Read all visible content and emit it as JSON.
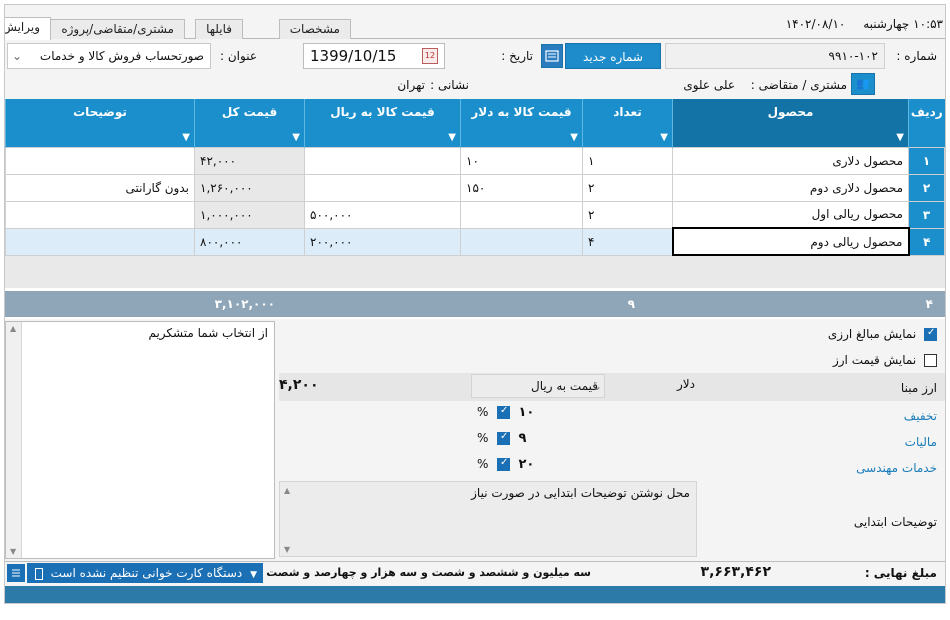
{
  "header": {
    "time": "۱۰:۵۳",
    "weekday": "چهارشنبه",
    "date": "۱۴۰۲/۰۸/۱۰"
  },
  "tabs": [
    {
      "label": "ویرایش"
    },
    {
      "label": "مشتری/متقاضی/پروژه"
    },
    {
      "label": "فایلها"
    },
    {
      "label": "مشخصات"
    }
  ],
  "invoice": {
    "number_label": "شماره :",
    "number_value": "۹۹۱۰-۱۰۲",
    "new_number_button": "شماره جدید",
    "date_label": "تاریخ :",
    "date_value": "1399/10/15",
    "title_label": "عنوان :",
    "title_value": "صورتحساب فروش کالا و خدمات",
    "customer_label": "مشتری / متقاضی :",
    "customer_value": "علی علوی",
    "address_label": "نشانی :",
    "address_value": "تهران"
  },
  "grid": {
    "columns": [
      "ردیف",
      "محصول",
      "تعداد",
      "قیمت کالا به دلار",
      "قیمت کالا به ریال",
      "قیمت کل",
      "توضیحات"
    ],
    "rows": [
      {
        "n": "۱",
        "product": "محصول دلاری",
        "qty": "۱",
        "usd": "۱۰",
        "rial": "",
        "total": "۴۲,۰۰۰",
        "desc": ""
      },
      {
        "n": "۲",
        "product": "محصول دلاری دوم",
        "qty": "۲",
        "usd": "۱۵۰",
        "rial": "",
        "total": "۱,۲۶۰,۰۰۰",
        "desc": "بدون گارانتی"
      },
      {
        "n": "۳",
        "product": "محصول ریالی اول",
        "qty": "۲",
        "usd": "",
        "rial": "۵۰۰,۰۰۰",
        "total": "۱,۰۰۰,۰۰۰",
        "desc": ""
      },
      {
        "n": "۴",
        "product": "محصول ریالی دوم",
        "qty": "۴",
        "usd": "",
        "rial": "۲۰۰,۰۰۰",
        "total": "۸۰۰,۰۰۰",
        "desc": ""
      }
    ],
    "totals": {
      "rows": "۴",
      "qty": "۹",
      "total": "۳,۱۰۲,۰۰۰"
    }
  },
  "notes_text": "از انتخاب شما متشکریم",
  "options": {
    "show_fx_amounts": "نمایش مبالغ ارزی",
    "show_fx_price": "نمایش قیمت ارز"
  },
  "fx": {
    "base_currency_label": "ارز مبنا",
    "currency": "دلار",
    "price_type": "قیمت به ریال",
    "rate": "۴,۲۰۰"
  },
  "adjustments": [
    {
      "label": "تخفیف",
      "value": "۱۰",
      "unit": "%"
    },
    {
      "label": "مالیات",
      "value": "۹",
      "unit": "%"
    },
    {
      "label": "خدمات مهندسی",
      "value": "۲۰",
      "unit": "%"
    }
  ],
  "intro": {
    "label": "توضیحات ابتدایی",
    "placeholder": "محل نوشتن توضیحات ابتدایی در صورت نیاز"
  },
  "status": {
    "final_label": "مبلغ نهایی :",
    "final_value": "۳,۶۶۳,۴۶۲",
    "final_words": "سه میلیون و ششصد و شصت و سه هزار و چهارصد و شصت و دو ریال",
    "card_reader": "دستگاه کارت خوانی تنظیم نشده است"
  },
  "colors": {
    "accent": "#1a8fcb",
    "dark_accent": "#1473a6"
  }
}
